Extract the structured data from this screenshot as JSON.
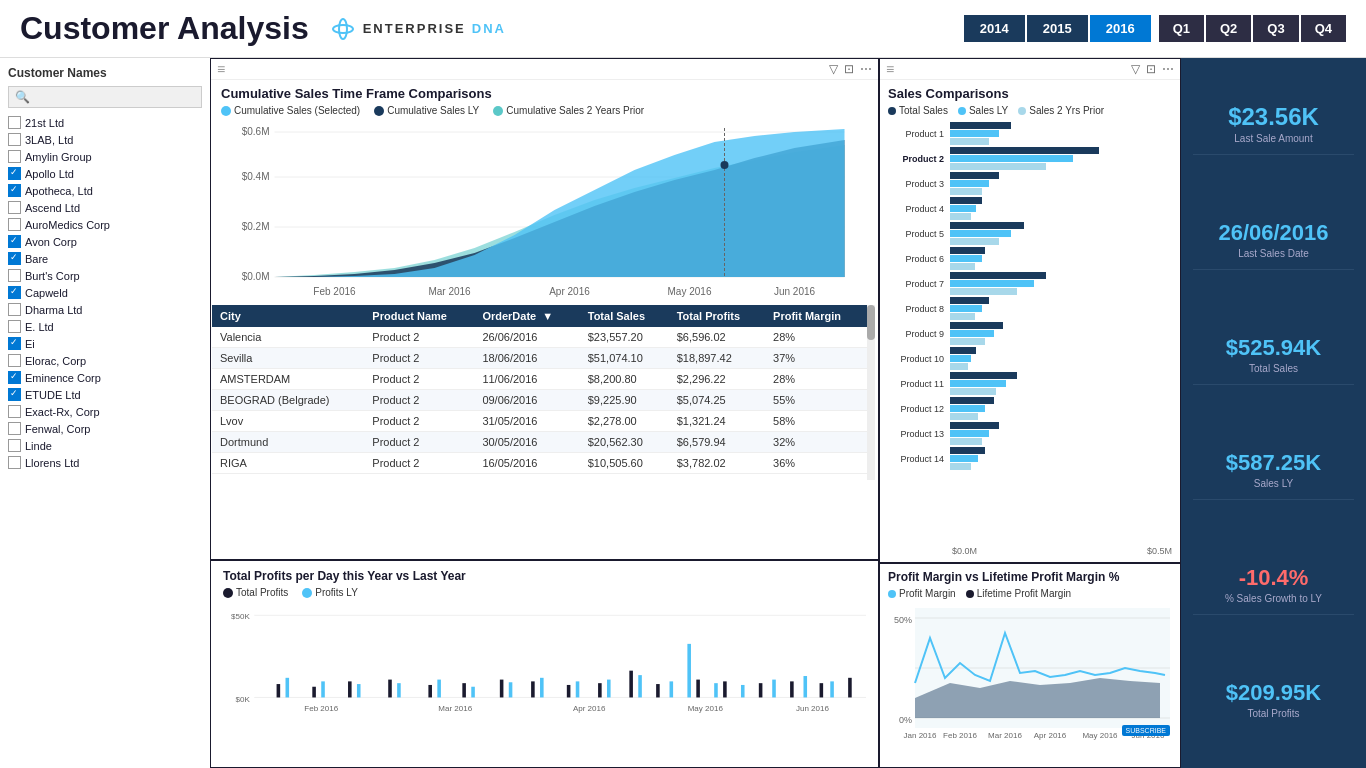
{
  "header": {
    "title": "Customer Analysis",
    "logo_enterprise": "ENTERPRISE",
    "logo_dna": "DNA",
    "years": [
      "2014",
      "2015",
      "2016"
    ],
    "active_year": "2016",
    "quarters": [
      "Q1",
      "Q2",
      "Q3",
      "Q4"
    ]
  },
  "sidebar": {
    "title": "Customer Names",
    "search_placeholder": "🔍",
    "customers": [
      {
        "name": "21st Ltd",
        "checked": false
      },
      {
        "name": "3LAB, Ltd",
        "checked": false
      },
      {
        "name": "Amylin Group",
        "checked": false
      },
      {
        "name": "Apollo Ltd",
        "checked": true
      },
      {
        "name": "Apotheca, Ltd",
        "checked": true
      },
      {
        "name": "Ascend Ltd",
        "checked": false
      },
      {
        "name": "AuroMedics Corp",
        "checked": false
      },
      {
        "name": "Avon Corp",
        "checked": true
      },
      {
        "name": "Bare",
        "checked": true
      },
      {
        "name": "Burt's Corp",
        "checked": false
      },
      {
        "name": "Capweld",
        "checked": true
      },
      {
        "name": "Dharma Ltd",
        "checked": false
      },
      {
        "name": "E. Ltd",
        "checked": false
      },
      {
        "name": "Ei",
        "checked": true
      },
      {
        "name": "Elorac, Corp",
        "checked": false
      },
      {
        "name": "Eminence Corp",
        "checked": true
      },
      {
        "name": "ETUDE Ltd",
        "checked": true
      },
      {
        "name": "Exact-Rx, Corp",
        "checked": false
      },
      {
        "name": "Fenwal, Corp",
        "checked": false
      },
      {
        "name": "Linde",
        "checked": false
      },
      {
        "name": "Llorens Ltd",
        "checked": false
      }
    ]
  },
  "cumulative_chart": {
    "title": "Cumulative Sales Time Frame Comparisons",
    "legend": [
      {
        "label": "Cumulative Sales (Selected)",
        "color": "#4fc3f7"
      },
      {
        "label": "Cumulative Sales LY",
        "color": "#1a3a5c"
      },
      {
        "label": "Cumulative Sales 2 Years Prior",
        "color": "#5bc8c8"
      }
    ],
    "y_labels": [
      "$0.6M",
      "$0.4M",
      "$0.2M",
      "$0.0M"
    ],
    "x_labels": [
      "Feb 2016",
      "Mar 2016",
      "Apr 2016",
      "May 2016",
      "Jun 2016"
    ]
  },
  "data_table": {
    "columns": [
      "City",
      "Product Name",
      "OrderDate",
      "Total Sales",
      "Total Profits",
      "Profit Margin"
    ],
    "rows": [
      {
        "city": "Valencia",
        "product": "Product 2",
        "date": "26/06/2016",
        "sales": "$23,557.20",
        "profits": "$6,596.02",
        "margin": "28%"
      },
      {
        "city": "Sevilla",
        "product": "Product 2",
        "date": "18/06/2016",
        "sales": "$51,074.10",
        "profits": "$18,897.42",
        "margin": "37%"
      },
      {
        "city": "AMSTERDAM",
        "product": "Product 2",
        "date": "11/06/2016",
        "sales": "$8,200.80",
        "profits": "$2,296.22",
        "margin": "28%"
      },
      {
        "city": "BEOGRAD (Belgrade)",
        "product": "Product 2",
        "date": "09/06/2016",
        "sales": "$9,225.90",
        "profits": "$5,074.25",
        "margin": "55%"
      },
      {
        "city": "Lvov",
        "product": "Product 2",
        "date": "31/05/2016",
        "sales": "$2,278.00",
        "profits": "$1,321.24",
        "margin": "58%"
      },
      {
        "city": "Dortmund",
        "product": "Product 2",
        "date": "30/05/2016",
        "sales": "$20,562.30",
        "profits": "$6,579.94",
        "margin": "32%"
      },
      {
        "city": "RIGA",
        "product": "Product 2",
        "date": "16/05/2016",
        "sales": "$10,505.60",
        "profits": "$3,782.02",
        "margin": "36%"
      }
    ]
  },
  "sales_comparisons": {
    "title": "Sales Comparisons",
    "legend": [
      {
        "label": "Total Sales",
        "color": "#1a3a5c"
      },
      {
        "label": "Sales LY",
        "color": "#4fc3f7"
      },
      {
        "label": "Sales 2 Yrs Prior",
        "color": "#a8d8ea"
      }
    ],
    "products": [
      {
        "name": "Product 1",
        "vals": [
          0.35,
          0.28,
          0.22
        ]
      },
      {
        "name": "Product 2",
        "vals": [
          0.85,
          0.7,
          0.55
        ],
        "bold": true
      },
      {
        "name": "Product 3",
        "vals": [
          0.28,
          0.22,
          0.18
        ]
      },
      {
        "name": "Product 4",
        "vals": [
          0.18,
          0.15,
          0.12
        ]
      },
      {
        "name": "Product 5",
        "vals": [
          0.42,
          0.35,
          0.28
        ]
      },
      {
        "name": "Product 6",
        "vals": [
          0.2,
          0.18,
          0.14
        ]
      },
      {
        "name": "Product 7",
        "vals": [
          0.55,
          0.48,
          0.38
        ]
      },
      {
        "name": "Product 8",
        "vals": [
          0.22,
          0.18,
          0.14
        ]
      },
      {
        "name": "Product 9",
        "vals": [
          0.3,
          0.25,
          0.2
        ]
      },
      {
        "name": "Product 10",
        "vals": [
          0.15,
          0.12,
          0.1
        ]
      },
      {
        "name": "Product 11",
        "vals": [
          0.38,
          0.32,
          0.26
        ]
      },
      {
        "name": "Product 12",
        "vals": [
          0.25,
          0.2,
          0.16
        ]
      },
      {
        "name": "Product 13",
        "vals": [
          0.28,
          0.22,
          0.18
        ]
      },
      {
        "name": "Product 14",
        "vals": [
          0.2,
          0.16,
          0.12
        ]
      }
    ],
    "x_labels": [
      "$0.0M",
      "$0.5M"
    ]
  },
  "kpis": {
    "last_sale_amount": "$23.56K",
    "last_sale_label": "Last Sale Amount",
    "last_sale_date": "26/06/2016",
    "last_sale_date_label": "Last Sales Date",
    "total_sales": "$525.94K",
    "total_sales_label": "Total Sales",
    "sales_ly": "$587.25K",
    "sales_ly_label": "Sales LY",
    "sales_growth": "-10.4%",
    "sales_growth_label": "% Sales Growth to LY",
    "total_profits": "$209.95K",
    "total_profits_label": "Total Profits"
  },
  "bottom_left": {
    "title": "Total Profits per Day this Year vs Last Year",
    "legend": [
      {
        "label": "Total Profits",
        "color": "#1a1a2e"
      },
      {
        "label": "Profits LY",
        "color": "#4fc3f7"
      }
    ],
    "y_labels": [
      "$50K",
      "$0K"
    ],
    "x_labels": [
      "Feb 2016",
      "Mar 2016",
      "Apr 2016",
      "May 2016",
      "Jun 2016"
    ]
  },
  "bottom_right": {
    "title": "Profit Margin vs Lifetime Profit Margin %",
    "legend": [
      {
        "label": "Profit Margin",
        "color": "#4fc3f7"
      },
      {
        "label": "Lifetime Profit Margin",
        "color": "#1a1a2e"
      }
    ],
    "y_labels": [
      "50%",
      "0%"
    ],
    "x_labels": [
      "Jan 2016",
      "Feb 2016",
      "Mar 2016",
      "Apr 2016",
      "May 2016",
      "Jun 2016"
    ],
    "subscribe": "SUBSCRIBE"
  }
}
